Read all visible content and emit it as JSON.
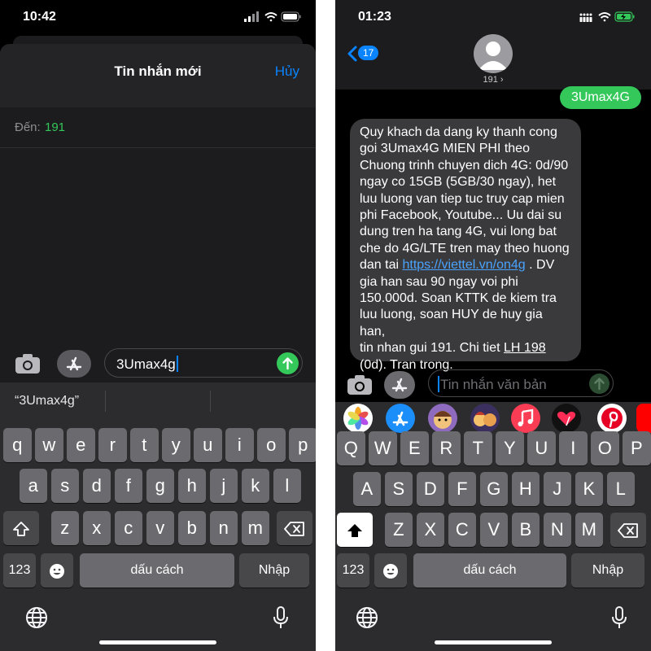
{
  "left": {
    "status_time": "10:42",
    "header_title": "Tin nhắn mới",
    "cancel_label": "Hủy",
    "to_label": "Đến:",
    "to_number": "191",
    "message_text": "3Umax4g",
    "suggestion": "“3Umax4g”",
    "keys": {
      "row1": [
        "q",
        "w",
        "e",
        "r",
        "t",
        "y",
        "u",
        "i",
        "o",
        "p"
      ],
      "row2": [
        "a",
        "s",
        "d",
        "f",
        "g",
        "h",
        "j",
        "k",
        "l"
      ],
      "row3": [
        "z",
        "x",
        "c",
        "v",
        "b",
        "n",
        "m"
      ],
      "numbers": "123",
      "space": "dấu cách",
      "return": "Nhập"
    }
  },
  "right": {
    "status_time": "01:23",
    "back_count": "17",
    "contact_name": "191",
    "sent_message": "3Umax4G",
    "received": {
      "lines": [
        "Quy khach da dang ky thanh cong",
        "goi 3Umax4G MIEN PHI theo",
        "Chuong trinh chuyen dich 4G: 0d/90",
        "ngay co 15GB (5GB/30 ngay), het",
        "luu luong van tiep tuc truy cap mien",
        "phi Facebook, Youtube... Uu dai su",
        "dung tren ha tang 4G, vui long bat",
        "che do 4G/LTE tren may theo huong"
      ],
      "line9_pre": "dan tai ",
      "link": "https://viettel.vn/on4g",
      "line9_post": " . DV",
      "lines2": [
        "gia han sau 90 ngay voi phi",
        "150.000d. Soan KTTK de kiem tra",
        "luu luong, soan HUY de huy gia han,"
      ],
      "line13_pre": "tin nhan gui 191. Chi tiet ",
      "line13_link": "LH 198",
      "line14": "(0d). Tran trong."
    },
    "input_placeholder": "Tin nhắn văn bản",
    "keys": {
      "row1": [
        "Q",
        "W",
        "E",
        "R",
        "T",
        "Y",
        "U",
        "I",
        "O",
        "P"
      ],
      "row2": [
        "A",
        "S",
        "D",
        "F",
        "G",
        "H",
        "J",
        "K",
        "L"
      ],
      "row3": [
        "Z",
        "X",
        "C",
        "V",
        "B",
        "N",
        "M"
      ],
      "numbers": "123",
      "space": "dấu cách",
      "return": "Nhập"
    }
  },
  "colors": {
    "accent_blue": "#0a84ff",
    "imessage_green": "#34c759",
    "keyboard_bg": "#2c2c2e",
    "key_bg": "#6b6b6f"
  }
}
